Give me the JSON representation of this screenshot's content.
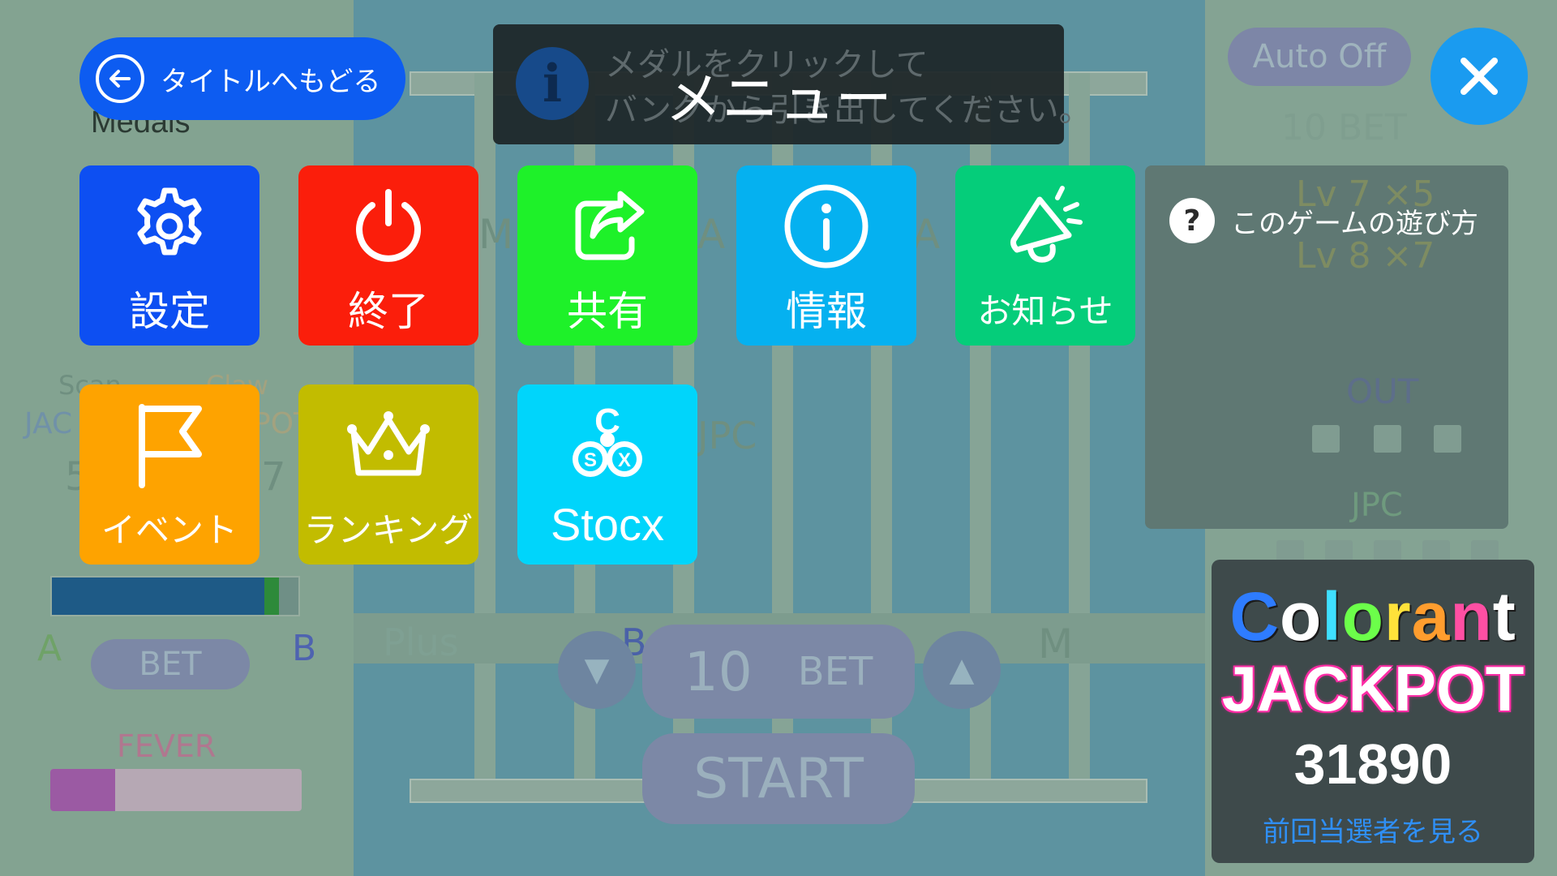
{
  "back_button": {
    "label": "タイトルへもどる"
  },
  "dialog": {
    "title": "メニュー",
    "hint_line1": "メダルをクリックして",
    "hint_line2": "バンクから引き出してください。"
  },
  "menu_tiles": [
    {
      "label": "設定",
      "icon": "gear-icon",
      "color": "#0d4ff2"
    },
    {
      "label": "終了",
      "icon": "power-icon",
      "color": "#fb1e0b"
    },
    {
      "label": "共有",
      "icon": "share-icon",
      "color": "#1ef129"
    },
    {
      "label": "情報",
      "icon": "info-icon",
      "color": "#05b1f0"
    },
    {
      "label": "お知らせ",
      "icon": "megaphone-icon",
      "color": "#05cd7a"
    },
    {
      "label": "イベント",
      "icon": "flag-icon",
      "color": "#fea300"
    },
    {
      "label": "ランキング",
      "icon": "crown-icon",
      "color": "#c2bc00"
    },
    {
      "label": "Stocx",
      "icon": "stocx-icon",
      "color": "#00d5fb"
    }
  ],
  "help": {
    "label": "このゲームの遊び方"
  },
  "jackpot": {
    "brand": "Colorant",
    "title": "JACKPOT",
    "value": "31890",
    "link": "前回当選者を見る"
  },
  "background": {
    "medals_label": "Medals",
    "auto": "Auto Off",
    "bet_top": "10 BET",
    "lv1": "Lv 7  ×5",
    "lv2": "Lv 8  ×7",
    "out": "OUT",
    "jpc": "JPC",
    "jpc_mid": "JPC",
    "bet_small": "BET",
    "bet_count": "10",
    "bet_word": "BET",
    "start": "START",
    "fever": "FEVER",
    "plus": "Plus",
    "letter_a": "A",
    "letter_b": "B",
    "letter_m": "M",
    "scan": "Scan",
    "claw": "Claw",
    "jac": "JAC",
    "pot": "POT",
    "num_left": "5",
    "num_right": "7",
    "up": "UP",
    "meter_a_fraction": 0.92,
    "fever_fraction": 0.26
  },
  "colors": {
    "overlay_back_button": "#0d5cf1",
    "close_button": "#1a9bf0",
    "jackpot_panel": "#3e4a4b",
    "jackpot_link": "#2f8ff5"
  }
}
